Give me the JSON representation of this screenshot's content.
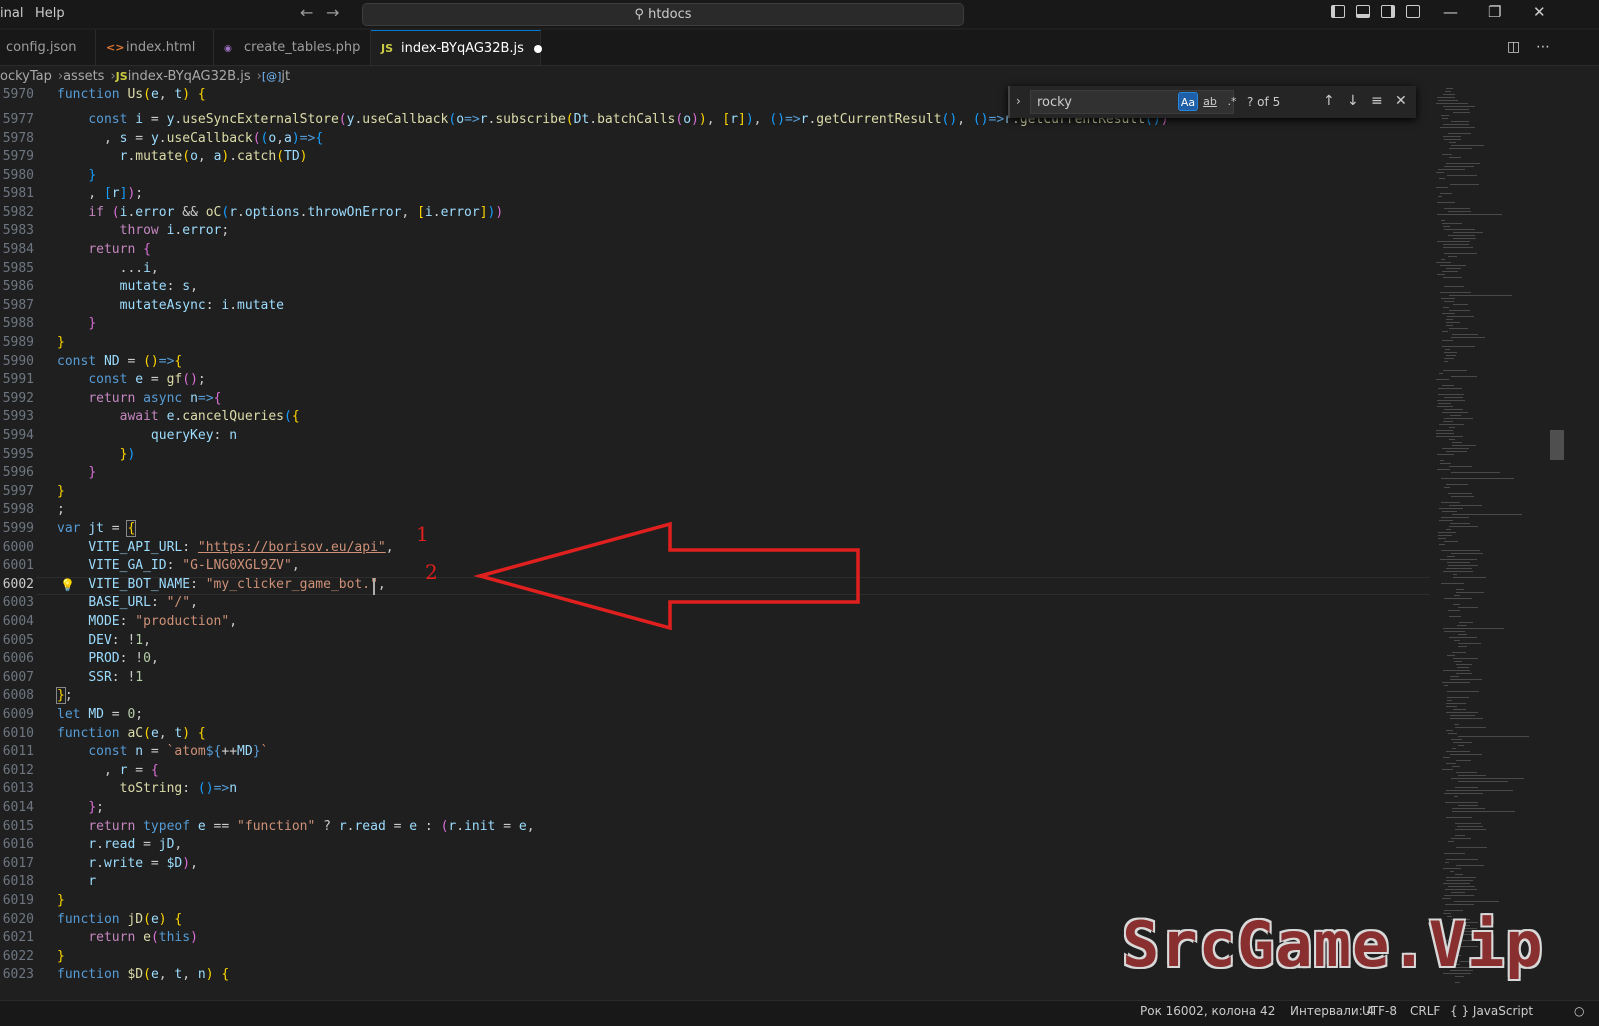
{
  "menu": {
    "terminal": "inal",
    "help": "Help"
  },
  "command_center": {
    "text": "htdocs"
  },
  "tabs": [
    {
      "label": "config.json",
      "icon": "{}",
      "icon_color": "#cbcb41"
    },
    {
      "label": "index.html",
      "icon": "<>",
      "icon_color": "#e37933"
    },
    {
      "label": "create_tables.php",
      "icon": "php",
      "icon_color": "#a074c4"
    },
    {
      "label": "index-BYqAG32B.js",
      "icon": "JS",
      "icon_color": "#cbcb41"
    }
  ],
  "breadcrumb": {
    "folder": "ockyTap",
    "subfolder": "assets",
    "file": "index-BYqAG32B.js",
    "symbol": "jt",
    "file_icon": "JS",
    "symbol_icon": "[@]"
  },
  "find": {
    "query": "rocky",
    "match_case": "Aa",
    "whole_word": "ab",
    "regex": ".*",
    "count": "? of 5"
  },
  "lines": {
    "n0": "5970",
    "n1": "5977",
    "n2": "5978",
    "n3": "5979",
    "n4": "5980",
    "n5": "5981",
    "n6": "5982",
    "n7": "5983",
    "n8": "5984",
    "n9": "5985",
    "n10": "5986",
    "n11": "5987",
    "n12": "5988",
    "n13": "5989",
    "n14": "5990",
    "n15": "5991",
    "n16": "5992",
    "n17": "5993",
    "n18": "5994",
    "n19": "5995",
    "n20": "5996",
    "n21": "5997",
    "n22": "5998",
    "n23": "5999",
    "n24": "6000",
    "n25": "6001",
    "n26": "6002",
    "n27": "6003",
    "n28": "6004",
    "n29": "6005",
    "n30": "6006",
    "n31": "6007",
    "n32": "6008",
    "n33": "6009",
    "n34": "6010",
    "n35": "6011",
    "n36": "6012",
    "n37": "6013",
    "n38": "6014",
    "n39": "6015",
    "n40": "6016",
    "n41": "6017",
    "n42": "6018",
    "n43": "6019",
    "n44": "6020",
    "n45": "6021",
    "n46": "6022",
    "n47": "6023"
  },
  "code": {
    "api_url": "\"https://borisov.eu/api\"",
    "ga_id": "\"G-LNG0XGL9ZV\"",
    "bot_name": "\"my_clicker_game_bot.\"",
    "base_url": "\"/\"",
    "mode": "\"production\""
  },
  "annotations": {
    "one": "1",
    "two": "2",
    "arrow_color": "#e0201e"
  },
  "watermark": "SrcGame.Vip",
  "status": {
    "position": "Рок 16002, колона 42",
    "indent": "Интервали: 4",
    "encoding": "UTF-8",
    "eol": "CRLF",
    "language": "{ } JavaScript"
  },
  "colors": {
    "editor_bg": "#1f1f1f",
    "accent": "#0078d4"
  }
}
